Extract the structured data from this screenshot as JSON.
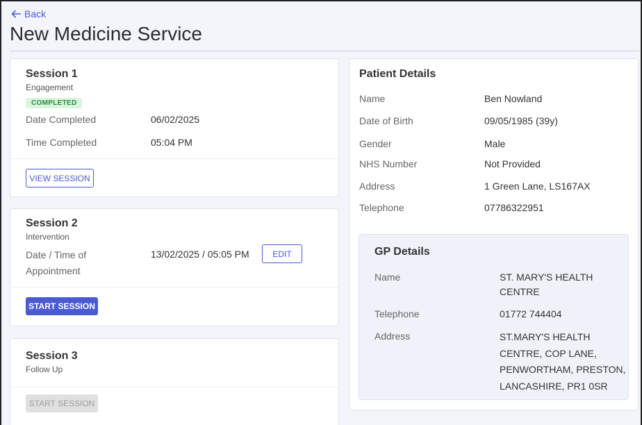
{
  "nav": {
    "back_label": "Back"
  },
  "page": {
    "title": "New Medicine Service"
  },
  "session1": {
    "title": "Session 1",
    "subtitle": "Engagement",
    "status_badge": "COMPLETED",
    "date_label": "Date Completed",
    "date_value": "06/02/2025",
    "time_label": "Time Completed",
    "time_value": "05:04 PM",
    "button_label": "VIEW SESSION"
  },
  "session2": {
    "title": "Session 2",
    "subtitle": "Intervention",
    "appointment_label_line1": "Date / Time of",
    "appointment_label_line2": "Appointment",
    "appointment_value": "13/02/2025 / 05:05 PM",
    "edit_label": "EDIT",
    "button_label": "START SESSION"
  },
  "session3": {
    "title": "Session 3",
    "subtitle": "Follow Up",
    "button_label": "START SESSION"
  },
  "patient": {
    "title": "Patient Details",
    "fields": [
      {
        "label": "Name",
        "value": "Ben Nowland"
      },
      {
        "label": "Date of Birth",
        "value": "09/05/1985 (39y)"
      },
      {
        "label": "Gender",
        "value": "Male"
      },
      {
        "label": "NHS Number",
        "value": "Not Provided"
      },
      {
        "label": "Address",
        "value": "1 Green Lane, LS167AX"
      },
      {
        "label": "Telephone",
        "value": "07786322951"
      }
    ]
  },
  "gp": {
    "title": "GP Details",
    "name_label": "Name",
    "name_line1": "ST. MARY'S HEALTH",
    "name_line2": "CENTRE",
    "telephone_label": "Telephone",
    "telephone_value": "01772 744404",
    "address_label": "Address",
    "address_line1": "ST.MARY'S HEALTH",
    "address_line2": "CENTRE, COP LANE,",
    "address_line3": "PENWORTHAM, PRESTON,",
    "address_line4": "LANCASHIRE, PR1 0SR"
  },
  "colors": {
    "accent": "#4a5bd1",
    "completed_badge_bg": "#d9f5df",
    "completed_badge_text": "#2a8a3c",
    "page_bg": "#f3f5fb"
  },
  "icons": {
    "back": "arrow-left-icon"
  }
}
